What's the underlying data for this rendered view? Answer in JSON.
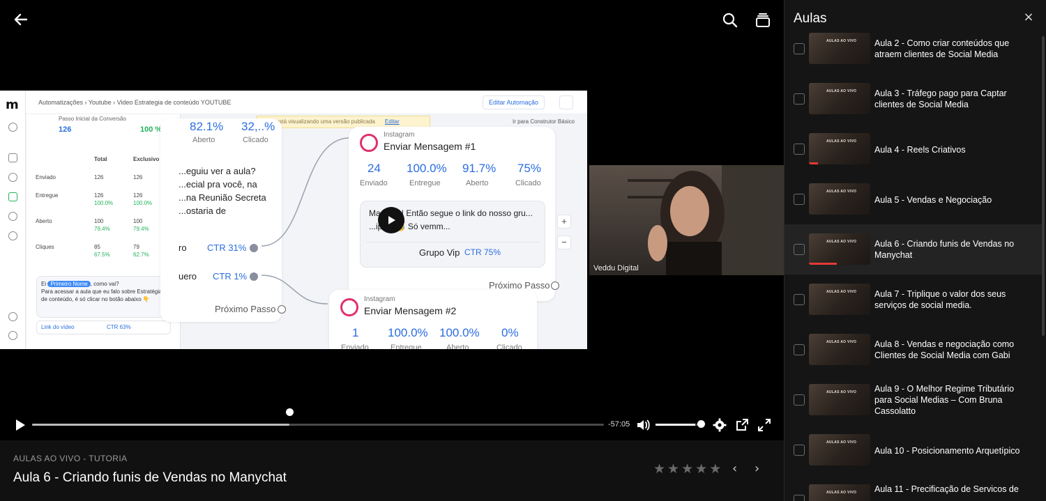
{
  "player": {
    "time_remaining": "-57:05",
    "progress_fraction": 0.45,
    "volume_fraction": 0.86
  },
  "screenshare": {
    "logo": "m",
    "breadcrumb": "Automatizações  ›  Youtube  ›  Video Estrategia de conteúdo YOUTUBE",
    "edit_button": "Editar Automação",
    "notice_text": "Você está visualizando uma versão publicada",
    "notice_link": "Editar",
    "basic_builder": "Ir para Construtor Básico",
    "panel": {
      "header": "Passo Inicial da Conversão",
      "count": "126",
      "percent": "100 %",
      "col_total": "Total",
      "col_exclusive": "Exclusivo",
      "rows": [
        {
          "label": "Enviado",
          "total": "126",
          "exclusive": "126"
        },
        {
          "label": "Entregue",
          "total": "126",
          "total_pc": "100.0%",
          "exclusive": "126",
          "exclusive_pc": "100.0%"
        },
        {
          "label": "Aberto",
          "total": "100",
          "total_pc": "79.4%",
          "exclusive": "100",
          "exclusive_pc": "79.4%"
        },
        {
          "label": "Cliques",
          "total": "85",
          "total_pc": "67.5%",
          "exclusive": "79",
          "exclusive_pc": "62.7%"
        }
      ],
      "chat_hello": "Ei",
      "chat_tag": "Primeiro Nome",
      "chat_hello_end": ", como vai?",
      "chat_body": "Para acessar a aula que eu falo sobre Estratégia de conteúdo, é só clicar no botão abaixo 👇",
      "chat_link": "Link do vídeo",
      "chat_ctr": "CTR 63%"
    },
    "left_node": {
      "m1": "82.1%",
      "m1_label": "Aberto",
      "m2": "32,..%",
      "m2_label": "Clicado",
      "text": "...eguiu ver a aula? ...ecial pra você, na ...na Reunião Secreta ...ostaria de",
      "opt1": "ro",
      "opt1_ctr": "CTR 31%",
      "opt2": "uero",
      "opt2_ctr": "CTR 1%",
      "next": "Próximo Passo"
    },
    "node1": {
      "sub": "Instagram",
      "title": "Enviar Mensagem #1",
      "metrics": [
        {
          "v": "24",
          "l": "Enviado"
        },
        {
          "v": "100.0%",
          "l": "Entregue"
        },
        {
          "v": "91.7%",
          "l": "Aberto"
        },
        {
          "v": "75%",
          "l": "Clicado"
        }
      ],
      "message": "Ma... ...e! Então segue o link do nosso gru... ...ip 👇🥳 Só vemm...",
      "button": "Grupo Vip",
      "button_ctr": "CTR 75%",
      "next": "Próximo Passo"
    },
    "node2": {
      "sub": "Instagram",
      "title": "Enviar Mensagem #2",
      "metrics": [
        {
          "v": "1",
          "l": "Enviado"
        },
        {
          "v": "100.0%",
          "l": "Entregue"
        },
        {
          "v": "100.0%",
          "l": "Aberto"
        },
        {
          "v": "0%",
          "l": "Clicado"
        }
      ]
    },
    "zoom_in": "+",
    "zoom_out": "−"
  },
  "webcam": {
    "label": "Veddu Digital"
  },
  "info": {
    "breadcrumb": "AULAS AO VIVO - TUTORIA",
    "title": "Aula 6 - Criando funis de Vendas no Manychat",
    "stars": [
      "★",
      "★",
      "★",
      "★",
      "★"
    ],
    "prev": "‹",
    "next": "›"
  },
  "panel": {
    "title": "Aulas",
    "close": "×",
    "thumb_text": "AULAS AO VIVO",
    "lessons": [
      {
        "label": "Aula 2 - Como criar conteúdos que atraem clientes de Social Media",
        "progress": 0
      },
      {
        "label": "Aula 3 - Tráfego pago para Captar clientes de Social Media",
        "progress": 0
      },
      {
        "label": "Aula 4 - Reels Criativos",
        "progress": 0.15
      },
      {
        "label": "Aula 5 - Vendas e Negociação",
        "progress": 0
      },
      {
        "label": "Aula 6 - Criando funis de Vendas no Manychat",
        "progress": 0.45,
        "active": true
      },
      {
        "label": "Aula 7 - Triplique o valor dos seus serviços de social media.",
        "progress": 0
      },
      {
        "label": "Aula 8 - Vendas e negociação como Clientes de Social Media com Gabi",
        "progress": 0
      },
      {
        "label": "Aula 9 - O Melhor Regime Tributário para Social Medias – Com Bruna Cassolatto",
        "progress": 0
      },
      {
        "label": "Aula 10 - Posicionamento Arquetípico",
        "progress": 0
      },
      {
        "label": "Aula 11 - Precificação de Servicos de",
        "progress": 0
      }
    ]
  },
  "colors": {
    "accent_blue": "#2a6de0",
    "progress_red": "#e53935",
    "success_green": "#23b35a"
  }
}
